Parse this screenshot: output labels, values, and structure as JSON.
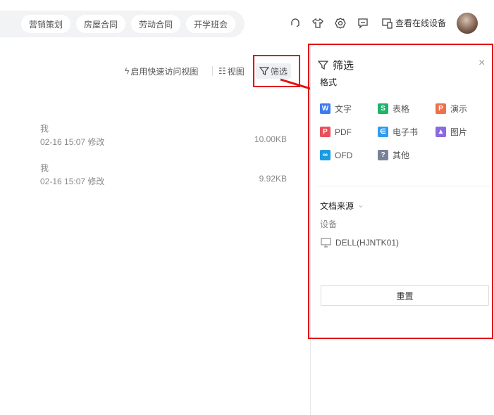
{
  "top_tags": [
    "营销策划",
    "房屋合同",
    "劳动合同",
    "开学班会"
  ],
  "header": {
    "online_devices": "查看在线设备"
  },
  "toolbar": {
    "quick_access": "启用快速访问视图",
    "view": "视图",
    "filter": "筛选"
  },
  "files": [
    {
      "owner": "我",
      "modified": "02-16 15:07 修改",
      "size": "10.00KB"
    },
    {
      "owner": "我",
      "modified": "02-16 15:07 修改",
      "size": "9.92KB"
    }
  ],
  "filter_panel": {
    "title": "筛选",
    "format_label": "格式",
    "formats": [
      {
        "label": "文字",
        "glyph": "W",
        "color": "#3b7cf0"
      },
      {
        "label": "表格",
        "glyph": "S",
        "color": "#1fb36b"
      },
      {
        "label": "演示",
        "glyph": "P",
        "color": "#f0704a"
      },
      {
        "label": "PDF",
        "glyph": "P",
        "color": "#e9505a"
      },
      {
        "label": "电子书",
        "glyph": "∈",
        "color": "#2f9bf0"
      },
      {
        "label": "图片",
        "glyph": "▲",
        "color": "#8a6be0"
      },
      {
        "label": "OFD",
        "glyph": "∞",
        "color": "#1d9be0"
      },
      {
        "label": "其他",
        "glyph": "?",
        "color": "#7a8299"
      }
    ],
    "source_label": "文档来源",
    "device_label": "设备",
    "device_name": "DELL(HJNTK01)",
    "reset": "重置"
  }
}
